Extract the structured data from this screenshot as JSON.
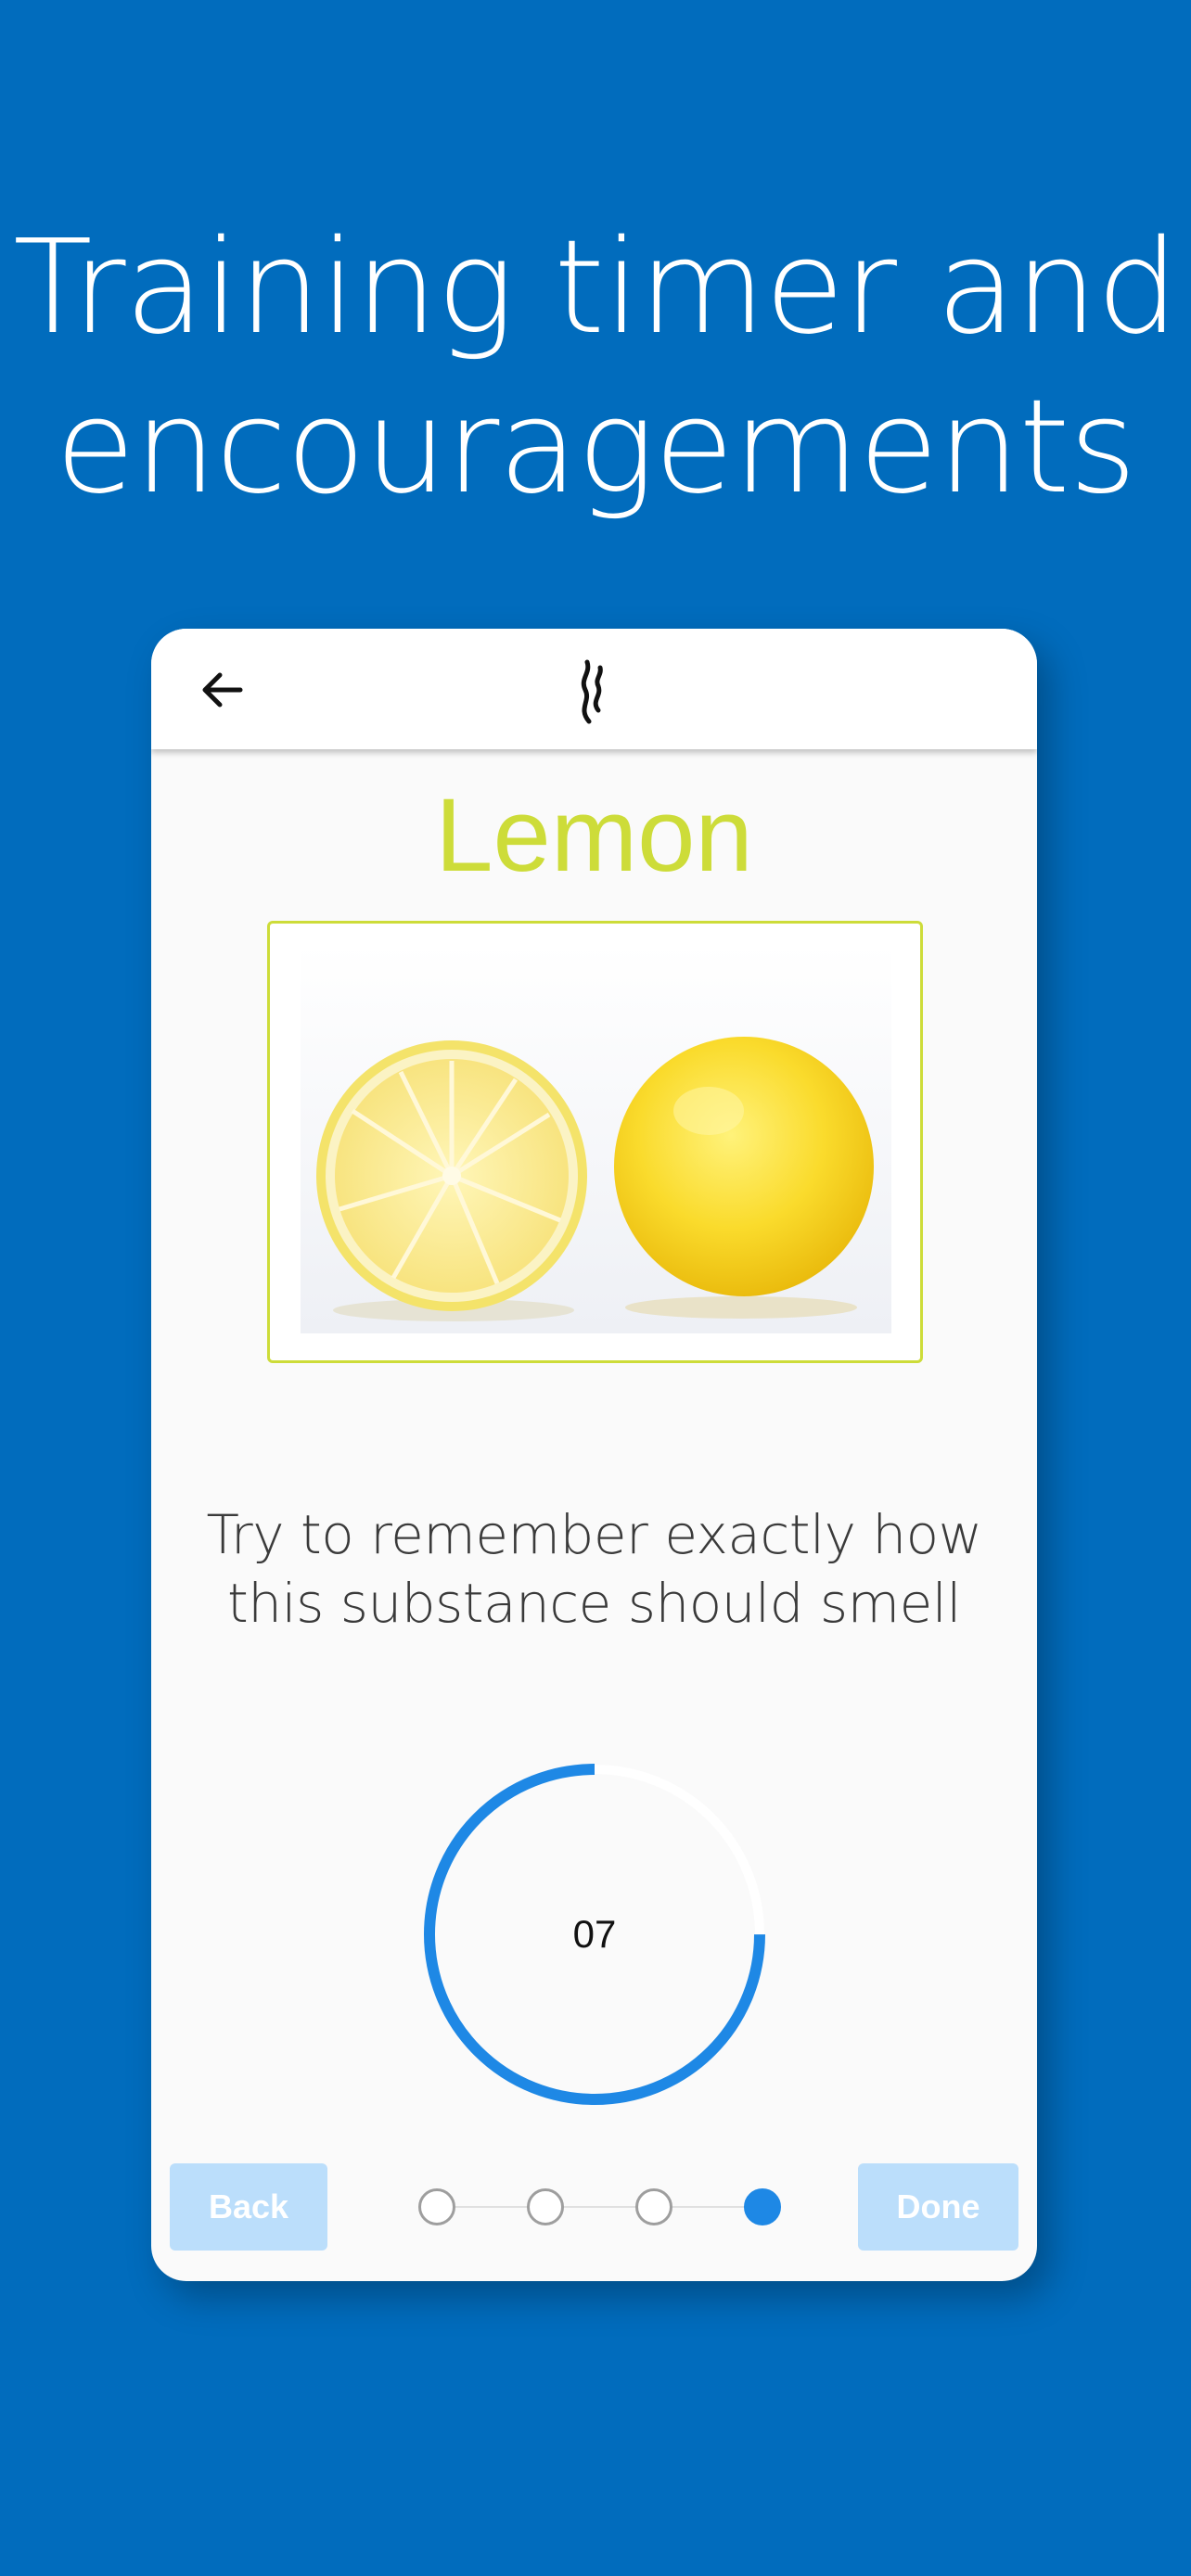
{
  "headline": {
    "line1": "Training timer and",
    "line2": "encouragements"
  },
  "app_bar": {
    "back_icon": "arrow-left-icon",
    "logo_icon": "smell-wave-icon"
  },
  "scent": {
    "name": "Lemon",
    "image": "lemon-halves-photo"
  },
  "instruction": {
    "line1": "Try to remember exactly how",
    "line2": "this substance should smell"
  },
  "timer": {
    "value": "07",
    "progress_fraction": 0.75
  },
  "navigation": {
    "back_label": "Back",
    "done_label": "Done",
    "steps_total": 4,
    "current_step": 4
  },
  "colors": {
    "background": "#016cbd",
    "accent_lime": "#cddc39",
    "timer_blue": "#1e88e5",
    "button_light_blue": "#bbdefb"
  }
}
